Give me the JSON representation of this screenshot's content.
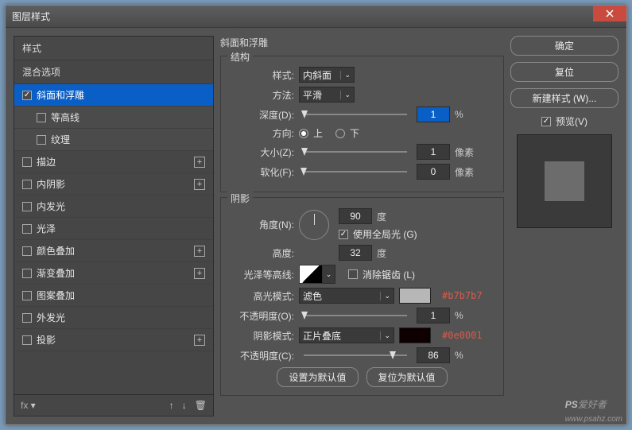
{
  "window": {
    "title": "图层样式"
  },
  "sidebar": {
    "styles_heading": "样式",
    "blend_heading": "混合选项",
    "items": [
      {
        "label": "斜面和浮雕",
        "checked": true,
        "selected": true,
        "has_plus": false
      },
      {
        "label": "等高线",
        "checked": false,
        "sub": true
      },
      {
        "label": "纹理",
        "checked": false,
        "sub": true
      },
      {
        "label": "描边",
        "checked": false,
        "has_plus": true
      },
      {
        "label": "内阴影",
        "checked": false,
        "has_plus": true
      },
      {
        "label": "内发光",
        "checked": false
      },
      {
        "label": "光泽",
        "checked": false
      },
      {
        "label": "颜色叠加",
        "checked": false,
        "has_plus": true
      },
      {
        "label": "渐变叠加",
        "checked": false,
        "has_plus": true
      },
      {
        "label": "图案叠加",
        "checked": false
      },
      {
        "label": "外发光",
        "checked": false
      },
      {
        "label": "投影",
        "checked": false,
        "has_plus": true
      }
    ],
    "footer": {
      "fx": "fx"
    }
  },
  "main": {
    "panel_title": "斜面和浮雕",
    "structure": {
      "title": "结构",
      "style_label": "样式:",
      "style_value": "内斜面",
      "method_label": "方法:",
      "method_value": "平滑",
      "depth_label": "深度(D):",
      "depth_value": "1",
      "depth_unit": "%",
      "direction_label": "方向:",
      "up_label": "上",
      "down_label": "下",
      "size_label": "大小(Z):",
      "size_value": "1",
      "size_unit": "像素",
      "soften_label": "软化(F):",
      "soften_value": "0",
      "soften_unit": "像素"
    },
    "shading": {
      "title": "阴影",
      "angle_label": "角度(N):",
      "angle_value": "90",
      "angle_unit": "度",
      "global_label": "使用全局光 (G)",
      "altitude_label": "高度:",
      "altitude_value": "32",
      "altitude_unit": "度",
      "gloss_label": "光泽等高线:",
      "antialias_label": "消除锯齿 (L)",
      "highlight_mode_label": "高光模式:",
      "highlight_mode_value": "滤色",
      "highlight_color_note": "#b7b7b7",
      "highlight_opacity_label": "不透明度(O):",
      "highlight_opacity_value": "1",
      "highlight_opacity_unit": "%",
      "shadow_mode_label": "阴影模式:",
      "shadow_mode_value": "正片叠底",
      "shadow_color_note": "#0e0001",
      "shadow_opacity_label": "不透明度(C):",
      "shadow_opacity_value": "86",
      "shadow_opacity_unit": "%"
    },
    "defaults": {
      "set": "设置为默认值",
      "reset": "复位为默认值"
    }
  },
  "right": {
    "ok": "确定",
    "reset": "复位",
    "new_style": "新建样式 (W)...",
    "preview": "预览(V)"
  },
  "watermark": {
    "brand": "PS",
    "text": "爱好者",
    "url": "www.psahz.com"
  }
}
